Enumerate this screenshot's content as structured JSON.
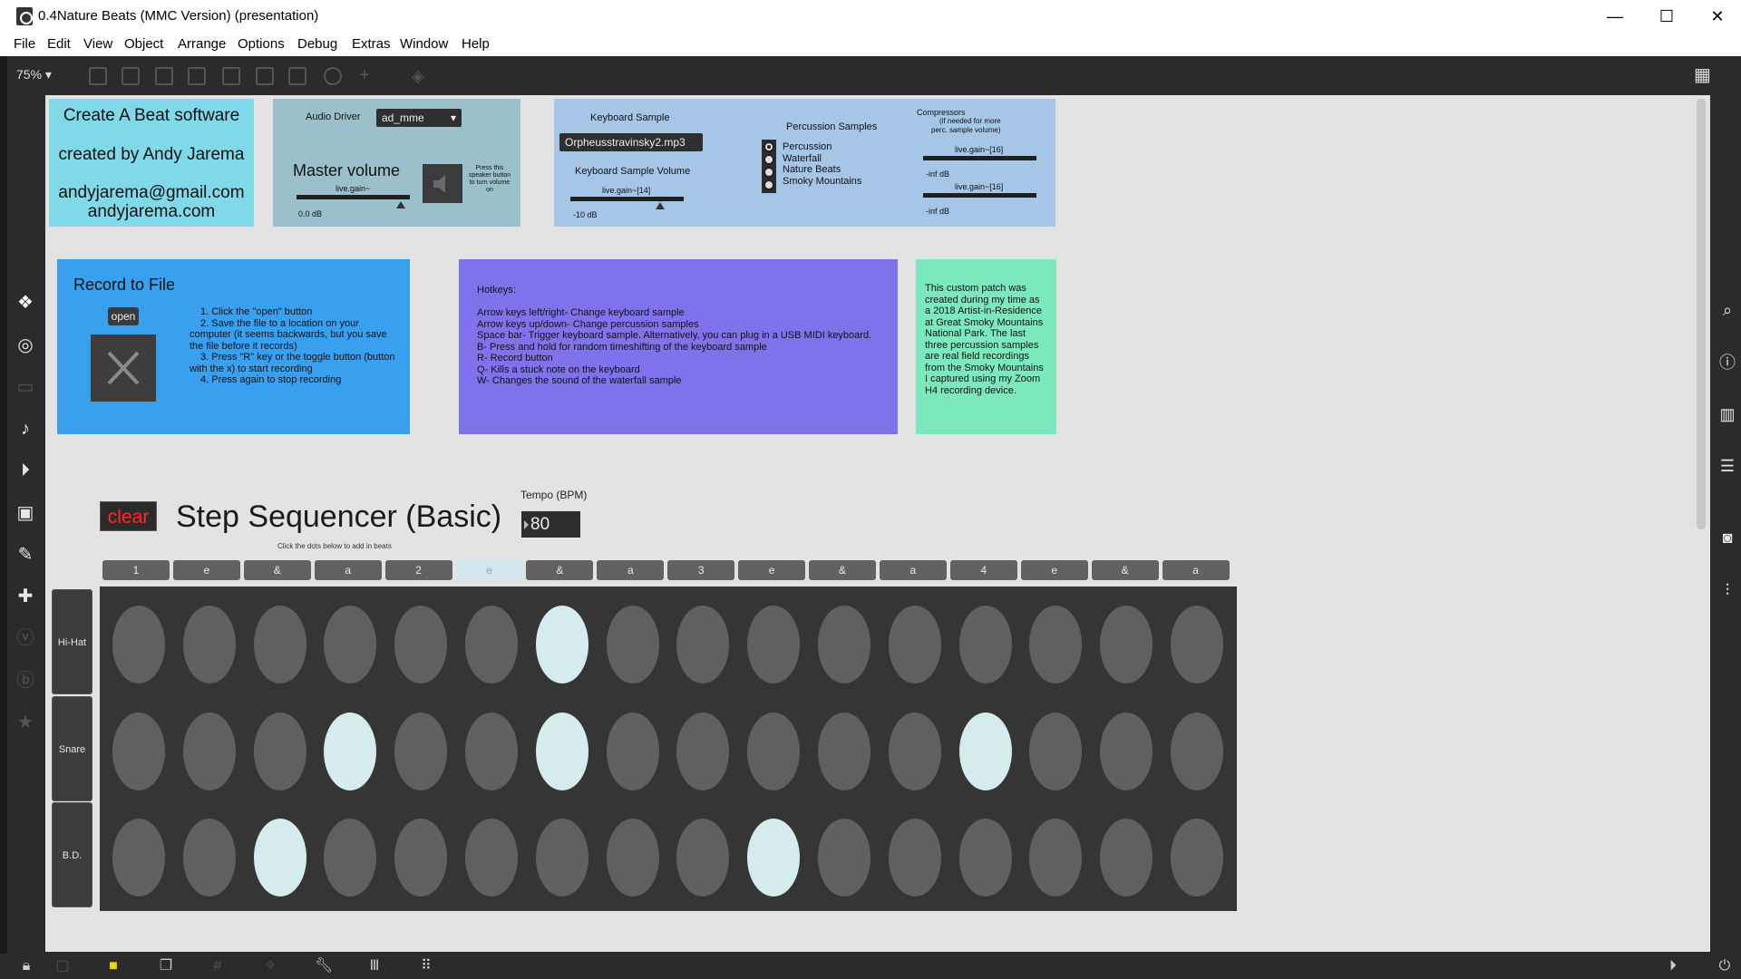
{
  "window": {
    "title": "0.4Nature Beats (MMC Version) (presentation)",
    "minimize": "—",
    "maximize": "☐",
    "close": "✕"
  },
  "menu": [
    "File",
    "Edit",
    "View",
    "Object",
    "Arrange",
    "Options",
    "Debug",
    "Extras",
    "Window",
    "Help"
  ],
  "toolbar": {
    "zoom": "75%"
  },
  "credits": {
    "title": "Create A Beat software",
    "author": "created by Andy Jarema",
    "email": "andyjarema@gmail.com",
    "site": "andyjarema.com"
  },
  "audio": {
    "driver_label": "Audio Driver",
    "driver_value": "ad_mme",
    "master_label": "Master volume",
    "gain_label": "live.gain~",
    "db": "0.0 dB",
    "speaker_hint": "Press this speaker button to turn volume on"
  },
  "keyboard": {
    "sample_label": "Keyboard Sample",
    "sample_value": "Orpheusstravinsky2.mp3",
    "volume_label": "Keyboard Sample Volume",
    "gain_label": "live.gain~[14]",
    "db": "-10 dB",
    "perc_label": "Percussion Samples",
    "perc_options": [
      "Percussion",
      "Waterfall",
      "Nature Beats",
      "Smoky Mountains"
    ],
    "perc_selected": 0,
    "comp_title": "Compressors",
    "comp_sub1": "(if needed for more",
    "comp_sub2": "perc. sample volume)",
    "comp1_label": "live.gain~[16]",
    "comp1_db": "-inf dB",
    "comp2_label": "live.gain~[16]",
    "comp2_db": "-inf dB"
  },
  "record": {
    "title": "Record to File",
    "open_label": "open",
    "steps": [
      "1.  Click the \"open\" button",
      "2.  Save the file to a location on your",
      "computer (it seems backwards, but you save",
      "the file before it records)",
      "3.  Press \"R\" key or the toggle button (button",
      "with the x) to start recording",
      "4.  Press again to stop recording"
    ]
  },
  "hotkeys": {
    "title": "Hotkeys:",
    "lines": [
      "Arrow keys left/right- Change keyboard sample",
      "Arrow keys up/down- Change percussion samples",
      "Space bar- Trigger keyboard sample.  Alternatively, you can plug in a USB MIDI keyboard.",
      "B- Press and hold for random timeshifting of the keyboard sample",
      "R- Record button",
      "Q- Kills a stuck note on the keyboard",
      "W- Changes the sound of the waterfall sample"
    ]
  },
  "note": {
    "lines": [
      "This custom patch was",
      "created during my time as",
      "a 2018 Artist-in-Residence",
      "at Great Smoky Mountains",
      "National Park.  The last",
      "three percussion samples",
      "are real field recordings",
      "from the Smoky Mountains",
      "I captured using my Zoom",
      "H4 recording device."
    ]
  },
  "sequencer": {
    "clear_label": "clear",
    "title": "Step Sequencer (Basic)",
    "hint": "Click the dots below to add in beats",
    "tempo_label": "Tempo (BPM)",
    "tempo_value": "80",
    "beats": [
      "1",
      "e",
      "&",
      "a",
      "2",
      "e",
      "&",
      "a",
      "3",
      "e",
      "&",
      "a",
      "4",
      "e",
      "&",
      "a"
    ],
    "highlight_beat": 5,
    "rows": [
      {
        "label": "Hi-Hat",
        "steps": [
          0,
          0,
          0,
          0,
          0,
          0,
          1,
          0,
          0,
          0,
          0,
          0,
          0,
          0,
          0,
          0
        ]
      },
      {
        "label": "Snare",
        "steps": [
          0,
          0,
          0,
          1,
          0,
          0,
          1,
          0,
          0,
          0,
          0,
          0,
          1,
          0,
          0,
          0
        ]
      },
      {
        "label": "B.D.",
        "steps": [
          0,
          0,
          1,
          0,
          0,
          0,
          0,
          0,
          0,
          1,
          0,
          0,
          0,
          0,
          0,
          0
        ]
      }
    ]
  }
}
